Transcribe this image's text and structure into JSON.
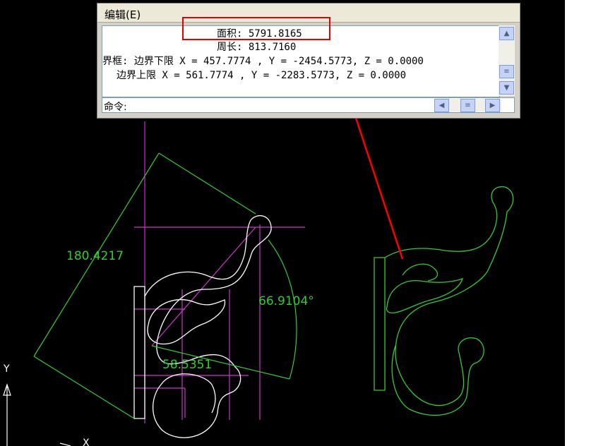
{
  "command_window": {
    "menu_edit": "编辑(E)",
    "history": [
      "面积: 5791.8165",
      "周长: 813.7160",
      "界框: 边界下限 X = 457.7774 , Y = -2454.5773, Z = 0.0000",
      "边界上限 X = 561.7774 , Y = -2283.5773, Z = 0.0000"
    ],
    "prompt": "命令:",
    "scroll_up": "▲",
    "scroll_down": "▼",
    "scroll_thumb": "≡",
    "scroll_left": "◀",
    "scroll_right": "▶",
    "scroll_hthumb": "≡"
  },
  "drawing": {
    "dim_length": "180.4217",
    "dim_angle": "66.9104°",
    "dim_length_2": "58.5351",
    "axis_y": "Y",
    "axis_x": "X",
    "colors": {
      "background": "#000000",
      "outline": "#ffffff",
      "construction": "#cc33cc",
      "dimension": "#33cc33",
      "callout": "#ff0000"
    }
  }
}
